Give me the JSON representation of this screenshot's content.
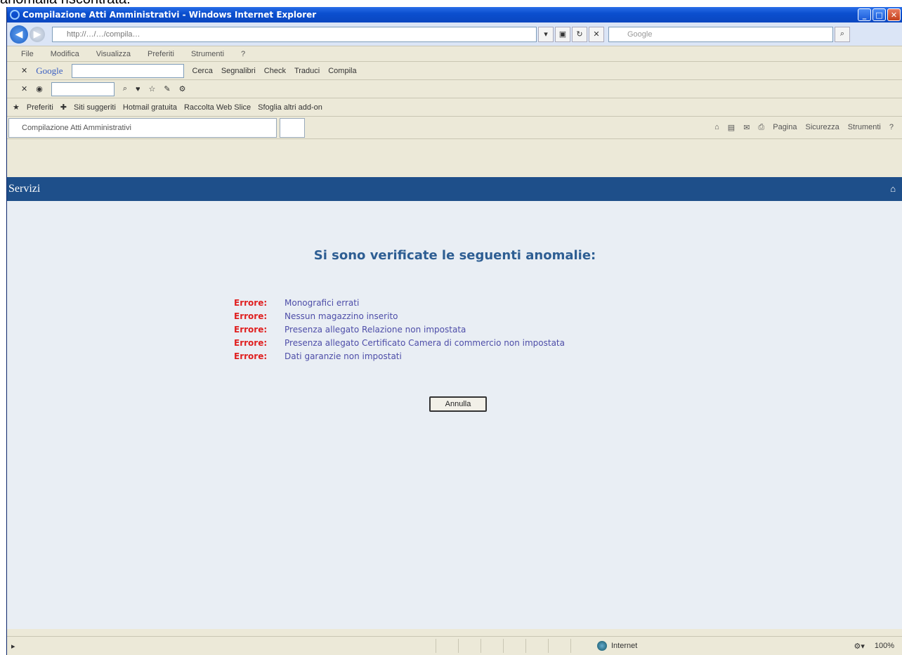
{
  "caption": "anomalia riscontrata:",
  "window": {
    "title": "Compilazione Atti Amministrativi - Windows Internet Explorer"
  },
  "addressbar": {
    "url": "http://…/…/compila…",
    "search_placeholder": "Google"
  },
  "menubar": {
    "items": [
      "File",
      "Modifica",
      "Visualizza",
      "Preferiti",
      "Strumenti",
      "?"
    ]
  },
  "google_toolbar": {
    "logo": "Google",
    "items": [
      "Cerca",
      "Segnalibri",
      "Check",
      "Traduci",
      "Compila"
    ]
  },
  "favorites_bar": {
    "label": "Preferiti",
    "items": [
      "Siti suggeriti",
      "Hotmail gratuita",
      "Raccolta Web Slice",
      "Sfoglia altri add-on"
    ]
  },
  "tab": {
    "title": "Compilazione Atti Amministrativi"
  },
  "command_bar": {
    "items": [
      "Pagina",
      "Sicurezza",
      "Strumenti"
    ]
  },
  "services_bar": {
    "title": "Servizi"
  },
  "main": {
    "heading": "Si sono verificate le seguenti anomalie:",
    "errors": [
      {
        "label": "Errore:",
        "message": "Monografici errati"
      },
      {
        "label": "Errore:",
        "message": "Nessun magazzino inserito"
      },
      {
        "label": "Errore:",
        "message": "Presenza allegato Relazione non impostata"
      },
      {
        "label": "Errore:",
        "message": "Presenza allegato Certificato Camera di commercio non impostata"
      },
      {
        "label": "Errore:",
        "message": "Dati garanzie non impostati"
      }
    ],
    "cancel_label": "Annulla"
  },
  "statusbar": {
    "zone": "Internet",
    "zoom": "100%"
  }
}
